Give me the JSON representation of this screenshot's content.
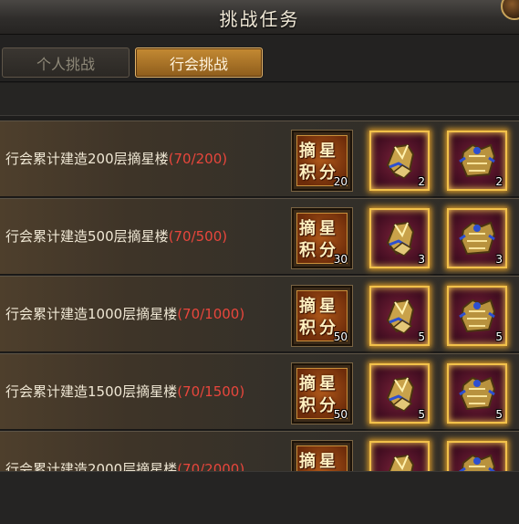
{
  "window": {
    "title": "挑战任务"
  },
  "tabs": [
    {
      "label": "个人挑战",
      "active": false
    },
    {
      "label": "行会挑战",
      "active": true
    }
  ],
  "score_item": {
    "line1": "摘星",
    "line2": "积分",
    "icon": "star-score-token-icon"
  },
  "tasks": [
    {
      "label": "行会累计建造200层摘星楼",
      "progress": "(70/200)",
      "score_count": "20",
      "reward_a_count": "2",
      "reward_b_count": "2"
    },
    {
      "label": "行会累计建造500层摘星楼",
      "progress": "(70/500)",
      "score_count": "30",
      "reward_a_count": "3",
      "reward_b_count": "3"
    },
    {
      "label": "行会累计建造1000层摘星楼",
      "progress": "(70/1000)",
      "score_count": "50",
      "reward_a_count": "5",
      "reward_b_count": "5"
    },
    {
      "label": "行会累计建造1500层摘星楼",
      "progress": "(70/1500)",
      "score_count": "50",
      "reward_a_count": "5",
      "reward_b_count": "5"
    },
    {
      "label": "行会累计建造2000层摘星楼",
      "progress": "(70/2000)",
      "score_count": "",
      "reward_a_count": "",
      "reward_b_count": ""
    }
  ],
  "colors": {
    "progress": "#e8463c",
    "accent": "#c48a33",
    "item_glow": "#f2c14a"
  }
}
